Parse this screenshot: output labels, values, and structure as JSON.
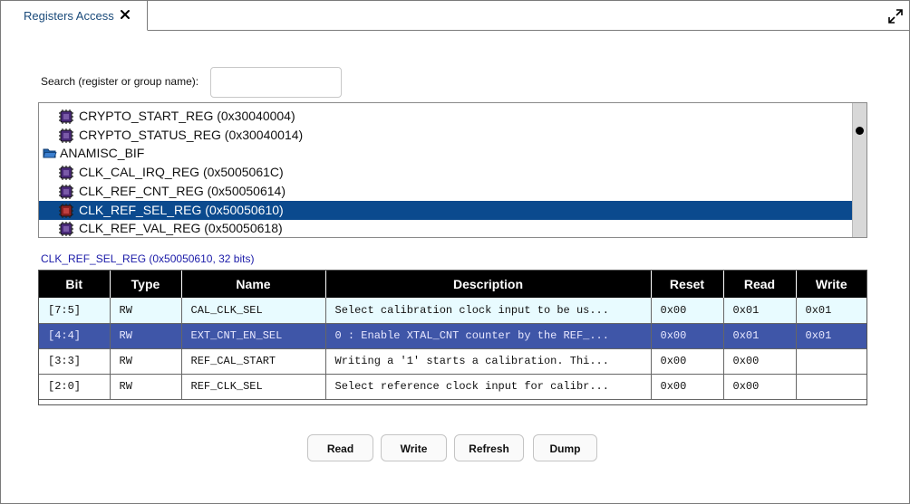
{
  "tab": {
    "label": "Registers Access"
  },
  "search": {
    "label": "Search (register or group name):",
    "value": ""
  },
  "tree": {
    "rows": [
      {
        "kind": "register",
        "label": "CRYPTO_START_REG (0x30040004)",
        "selected": false
      },
      {
        "kind": "register",
        "label": "CRYPTO_STATUS_REG (0x30040014)",
        "selected": false
      },
      {
        "kind": "group",
        "label": "ANAMISC_BIF",
        "selected": false
      },
      {
        "kind": "register",
        "label": "CLK_CAL_IRQ_REG (0x5005061C)",
        "selected": false
      },
      {
        "kind": "register",
        "label": "CLK_REF_CNT_REG (0x50050614)",
        "selected": false
      },
      {
        "kind": "register",
        "label": "CLK_REF_SEL_REG (0x50050610)",
        "selected": true
      },
      {
        "kind": "register",
        "label": "CLK_REF_VAL_REG (0x50050618)",
        "selected": false
      }
    ]
  },
  "register_title": "CLK_REF_SEL_REG (0x50050610, 32 bits)",
  "table": {
    "headers": [
      "Bit",
      "Type",
      "Name",
      "Description",
      "Reset",
      "Read",
      "Write"
    ],
    "rows": [
      {
        "bit": "[7:5]",
        "type": "RW",
        "name": "CAL_CLK_SEL",
        "description": "Select calibration clock input to be us...",
        "reset": "0x00",
        "read": "0x01",
        "write": "0x01",
        "style": "light"
      },
      {
        "bit": "[4:4]",
        "type": "RW",
        "name": "EXT_CNT_EN_SEL",
        "description": "0 : Enable XTAL_CNT counter by the REF_...",
        "reset": "0x00",
        "read": "0x01",
        "write": "0x01",
        "style": "selected"
      },
      {
        "bit": "[3:3]",
        "type": "RW",
        "name": "REF_CAL_START",
        "description": "Writing a '1' starts a calibration. Thi...",
        "reset": "0x00",
        "read": "0x00",
        "write": "",
        "style": "plain"
      },
      {
        "bit": "[2:0]",
        "type": "RW",
        "name": "REF_CLK_SEL",
        "description": "Select reference clock input for calibr...",
        "reset": "0x00",
        "read": "0x00",
        "write": "",
        "style": "plain"
      }
    ]
  },
  "buttons": {
    "read": "Read",
    "write": "Write",
    "refresh": "Refresh",
    "dump": "Dump"
  },
  "colors": {
    "selection": "#0b4a8e",
    "table_selection": "#3f56a8",
    "title_blue": "#1a1aa8"
  }
}
